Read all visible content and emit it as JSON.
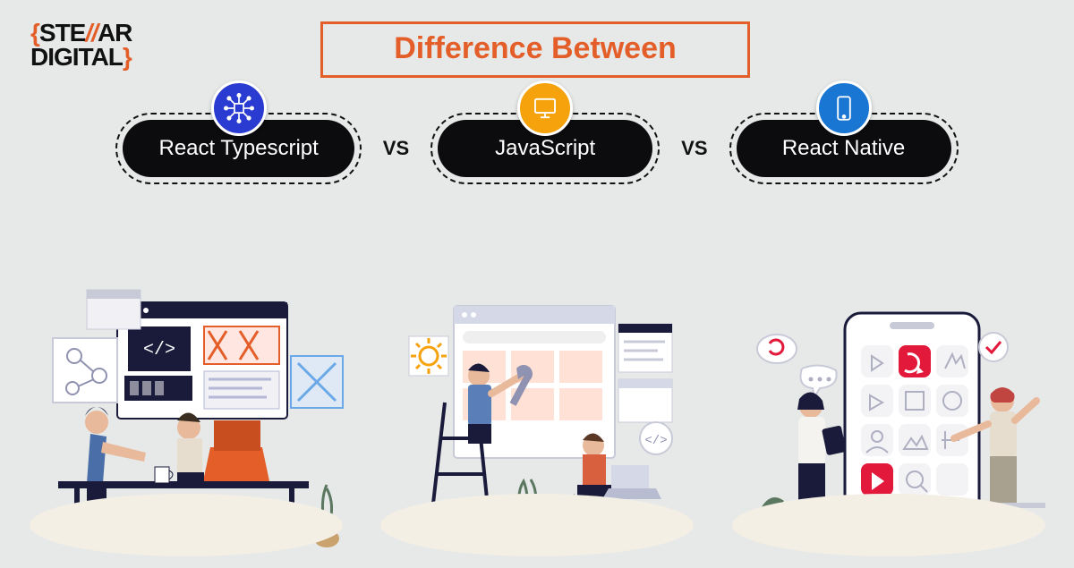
{
  "brand": {
    "line1_open_brace": "{",
    "line1_a": "STE",
    "line1_slashes": "//",
    "line1_b": "AR",
    "line2": "DIGITAL",
    "line2_close_brace": "}"
  },
  "title": "Difference Between",
  "vs": "VS",
  "pills": [
    {
      "label": "React Typescript",
      "icon": "tech-icon",
      "icon_bg": "#2a3bd1"
    },
    {
      "label": "JavaScript",
      "icon": "monitor-icon",
      "icon_bg": "#f5a20d"
    },
    {
      "label": "React Native",
      "icon": "phone-icon",
      "icon_bg": "#1976d2"
    }
  ],
  "colors": {
    "accent": "#e35e28",
    "bg": "#e7e9e9",
    "pill_bg": "#0c0c0f"
  }
}
